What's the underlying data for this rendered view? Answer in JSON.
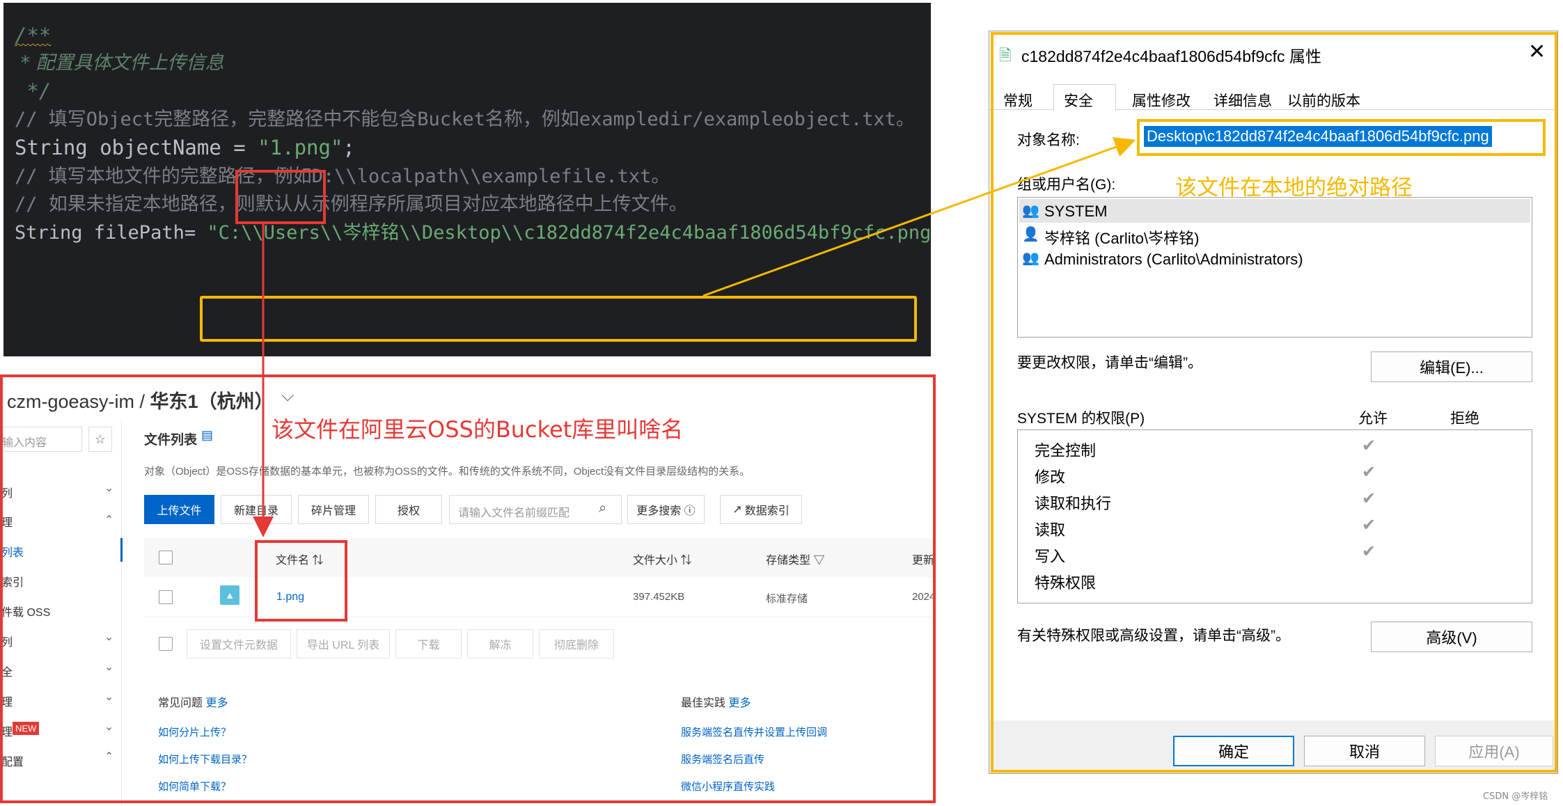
{
  "code": {
    "lines": [
      "/**",
      " * 配置具体文件上传信息",
      " */",
      "// 填写Object完整路径，完整路径中不能包含Bucket名称，例如exampledir/exampleobject.txt。",
      "String objectName = \"1.png\";",
      "// 填写本地文件的完整路径，例如D:\\\\localpath\\\\examplefile.txt。",
      "// 如果未指定本地路径，则默认从示例程序所属项目对应本地路径中上传文件。",
      "String filePath= \"C:\\\\Users\\\\岑梓铭\\\\Desktop\\\\c182dd874f2e4c4baaf1806d54bf9cfc.png\";"
    ],
    "line4_prefix": "String objectName = ",
    "line4_string": "\"1.png\"",
    "line4_suffix": ";",
    "line7_prefix": "String filePath= ",
    "line7_string": "\"C:\\\\Users\\\\岑梓铭\\\\Desktop\\\\c182dd874f2e4c4baaf1806d54bf9cfc.png\"",
    "line7_suffix": ";"
  },
  "oss": {
    "breadcrumb_bucket": "czm-goeasy-im",
    "breadcrumb_sep": " / ",
    "breadcrumb_region": "华东1（杭州）",
    "sidebar_search_placeholder": "输入内容",
    "sidebar_items": [
      "列",
      "理",
      "列表",
      "索引",
      "件载 OSS",
      "列",
      "全",
      "理",
      "理",
      "配置"
    ],
    "sidebar_new_badge": "NEW",
    "file_list_title": "文件列表",
    "description": "对象（Object）是OSS存储数据的基本单元，也被称为OSS的文件。和传统的文件系统不同，Object没有文件目录层级结构的关系。",
    "toolbar": {
      "upload": "上传文件",
      "new_dir": "新建目录",
      "fragments": "碎片管理",
      "authorize": "授权",
      "search_placeholder": "请输入文件名前缀匹配",
      "more_search": "更多搜索 ⓘ",
      "data_index": "数据索引"
    },
    "table": {
      "headers": [
        "文件名",
        "文件大小",
        "存储类型",
        "更新"
      ],
      "rows": [
        {
          "name": "1.png",
          "size": "397.452KB",
          "storage": "标准存储",
          "updated": "2024"
        }
      ]
    },
    "batch": [
      "设置文件元数据",
      "导出 URL 列表",
      "下载",
      "解冻",
      "彻底删除"
    ],
    "faq_title": "常见问题",
    "faq_more": "更多",
    "faq_links": [
      "如何分片上传？",
      "如何上传下载目录？",
      "如何简单下载？"
    ],
    "best_title": "最佳实践",
    "best_more": "更多",
    "best_links": [
      "服务端签名直传并设置上传回调",
      "服务端签名后直传",
      "微信小程序直传实践"
    ]
  },
  "dialog": {
    "title": "c182dd874f2e4c4baaf1806d54bf9cfc 属性",
    "tabs": [
      "常规",
      "安全",
      "属性修改",
      "详细信息",
      "以前的版本"
    ],
    "active_tab": "安全",
    "object_name_label": "对象名称:",
    "object_name_value": "Desktop\\c182dd874f2e4c4baaf1806d54bf9cfc.png",
    "group_label": "组或用户名(G):",
    "users": [
      "SYSTEM",
      "岑梓铭 (Carlito\\岑梓铭)",
      "Administrators (Carlito\\Administrators)"
    ],
    "change_perm_text": "要更改权限，请单击“编辑”。",
    "edit_button": "编辑(E)...",
    "perm_header": "SYSTEM 的权限(P)",
    "allow": "允许",
    "deny": "拒绝",
    "permissions": [
      "完全控制",
      "修改",
      "读取和执行",
      "读取",
      "写入",
      "特殊权限"
    ],
    "advanced_text": "有关特殊权限或高级设置，请单击“高级”。",
    "advanced_button": "高级(V)",
    "ok": "确定",
    "cancel": "取消",
    "apply": "应用(A)"
  },
  "annotations": {
    "red": "该文件在阿里云OSS的Bucket库里叫啥名",
    "orange": "该文件在本地的绝对路径"
  },
  "watermark": "CSDN @岑梓铭",
  "colors": {
    "code_bg": "#1e1f22",
    "string_green": "#6aab73",
    "red_box": "#e53935",
    "orange_box": "#f5b800",
    "oss_primary": "#0064c8"
  }
}
